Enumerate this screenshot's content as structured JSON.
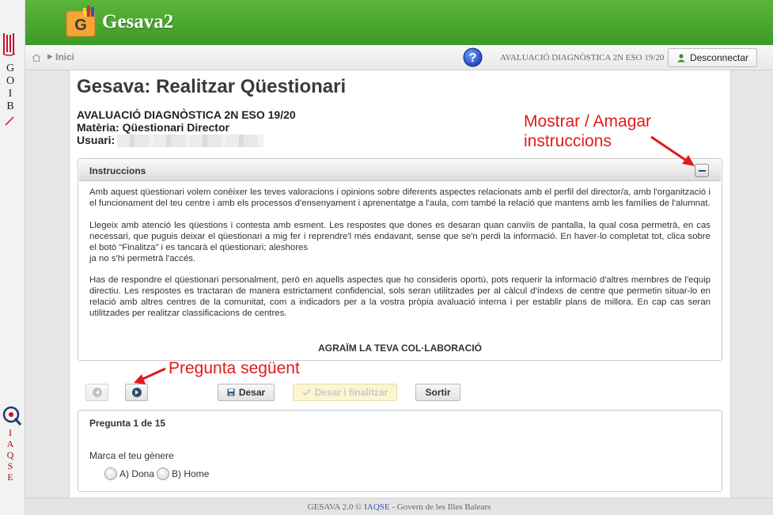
{
  "leftbar": {
    "goib_letters": [
      "G",
      "O",
      "I",
      "B"
    ],
    "iaqse_letters": [
      "I",
      "A",
      "Q",
      "S",
      "E"
    ]
  },
  "header": {
    "app_title": "Gesava2",
    "logo_letter": "G",
    "brand_color": "#4caf35"
  },
  "breadcrumb": {
    "home_icon": "home-icon",
    "label": "Inici"
  },
  "topbar": {
    "help_icon": "help-icon",
    "questionnaire_label": "AVALUACIÓ DIAGNÒSTICA 2N ESO 19/20",
    "logout_label": "Desconnectar",
    "logout_icon": "user-icon"
  },
  "page": {
    "title": "Gesava: Realitzar Qüestionari",
    "evaluation": "AVALUACIÓ DIAGNÒSTICA 2N ESO 19/20",
    "subject": "Matèria: Qüestionari Director",
    "user_label": "Usuari:"
  },
  "instructions": {
    "title": "Instruccions",
    "collapse_icon": "minus-icon",
    "paragraphs": [
      "Amb aquest qüestionari volem conèixer les teves valoracions i opinions sobre diferents aspectes relacionats amb el perfil del director/a, amb l'organització i el funcionament del teu centre i amb els processos d'ensenyament i aprenentatge a l'aula, com també la relació que mantens amb les famílies de l'alumnat.",
      "Llegeix amb atenció les qüestions i contesta amb esment. Les respostes que dones es desaran quan canviïs de pantalla, la qual cosa permetrà, en cas necessari, que puguis deixar el qüestionari a mig fer i reprendre'l més endavant, sense que se'n perdi la informació. En haver-lo completat tot, clica sobre el botó “Finalitza” i es tancarà el qüestionari; aleshores",
      "ja no s'hi permetrà l'accés.",
      "Has de respondre el qüestionari personalment, però en aquells aspectes que ho consideris oportú, pots requerir la informació d'altres membres de l'equip directiu. Les respostes es tractaran de manera estrictament confidencial, sols seran utilitzades per al càlcul d'índexs de centre que permetin situar-lo en relació amb altres centres de la comunitat, com a indicadors per a la vostra pròpia avaluació interna i per establir plans de millora. En cap cas seran utilitzades per realitzar classificacions de centres."
    ],
    "thanks": "AGRAÏM LA TEVA COL·LABORACIÓ"
  },
  "toolbar": {
    "prev_icon": "previous-icon",
    "next_icon": "next-icon",
    "save_label": "Desar",
    "save_icon": "floppy-icon",
    "save_finish_label": "Desar i finalitzar",
    "save_finish_icon": "check-icon",
    "exit_label": "Sortir"
  },
  "question": {
    "counter": "Pregunta 1 de 15",
    "text": "Marca el teu gènere",
    "options": [
      "A) Dona",
      "B) Home"
    ]
  },
  "footer": {
    "prefix": "GESAVA 2.0 © ",
    "link": "IAQSE",
    "suffix": " - Govern de les Illes Balears"
  },
  "annotations": {
    "toggle_note_line1": "Mostrar / Amagar",
    "toggle_note_line2": "instruccions",
    "next_note": "Pregunta següent",
    "color": "#e01b1b"
  }
}
